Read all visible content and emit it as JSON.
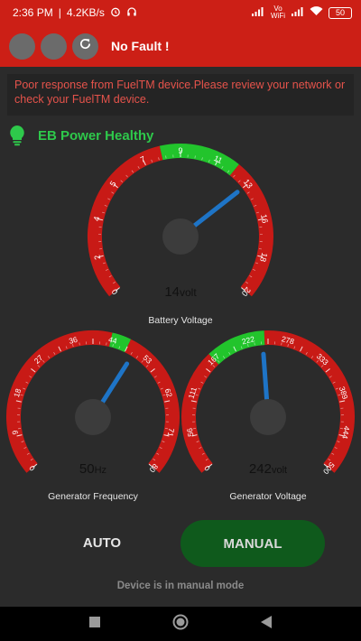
{
  "status_bar": {
    "time": "2:36 PM",
    "speed": "4.2KB/s",
    "network_label": "Vo WiFi",
    "battery": "50"
  },
  "app_bar": {
    "title": "No Fault !"
  },
  "warning": {
    "message": "Poor response from FuelTM device.Please review your network or check your FuelTM device."
  },
  "health": {
    "text": "EB Power Healthy",
    "color": "#2ec94b"
  },
  "gauges": [
    {
      "id": "battery",
      "title": "Battery Voltage",
      "min": 0,
      "max": 20,
      "ticks": [
        "0",
        "2",
        "4",
        "5",
        "7",
        "9",
        "11",
        "13",
        "16",
        "18",
        "20"
      ],
      "green_range": [
        9,
        13
      ],
      "value": 14,
      "readout": "14",
      "unit": "volt"
    },
    {
      "id": "gen_freq",
      "title": "Generator Frequency",
      "min": 0,
      "max": 80,
      "ticks": [
        "0",
        "9",
        "18",
        "27",
        "36",
        "44",
        "53",
        "62",
        "71",
        "80"
      ],
      "green_range": [
        44,
        48
      ],
      "value": 50,
      "readout": "50",
      "unit": "Hz"
    },
    {
      "id": "gen_volt",
      "title": "Generator Voltage",
      "min": 0,
      "max": 500,
      "ticks": [
        "0",
        "56",
        "111",
        "167",
        "222",
        "278",
        "333",
        "389",
        "444",
        "500"
      ],
      "green_range": [
        167,
        245
      ],
      "value": 242,
      "readout": "242",
      "unit": "volt"
    }
  ],
  "colors": {
    "red": "#c81a16",
    "green": "#22c42c",
    "needle": "#1e74c6",
    "hub": "#3c3c3c"
  },
  "mode_buttons": {
    "auto_label": "AUTO",
    "manual_label": "MANUAL",
    "selected": "MANUAL"
  },
  "mode_status": "Device is in manual mode",
  "nav_icons": [
    "recents-icon",
    "home-icon",
    "back-icon"
  ]
}
